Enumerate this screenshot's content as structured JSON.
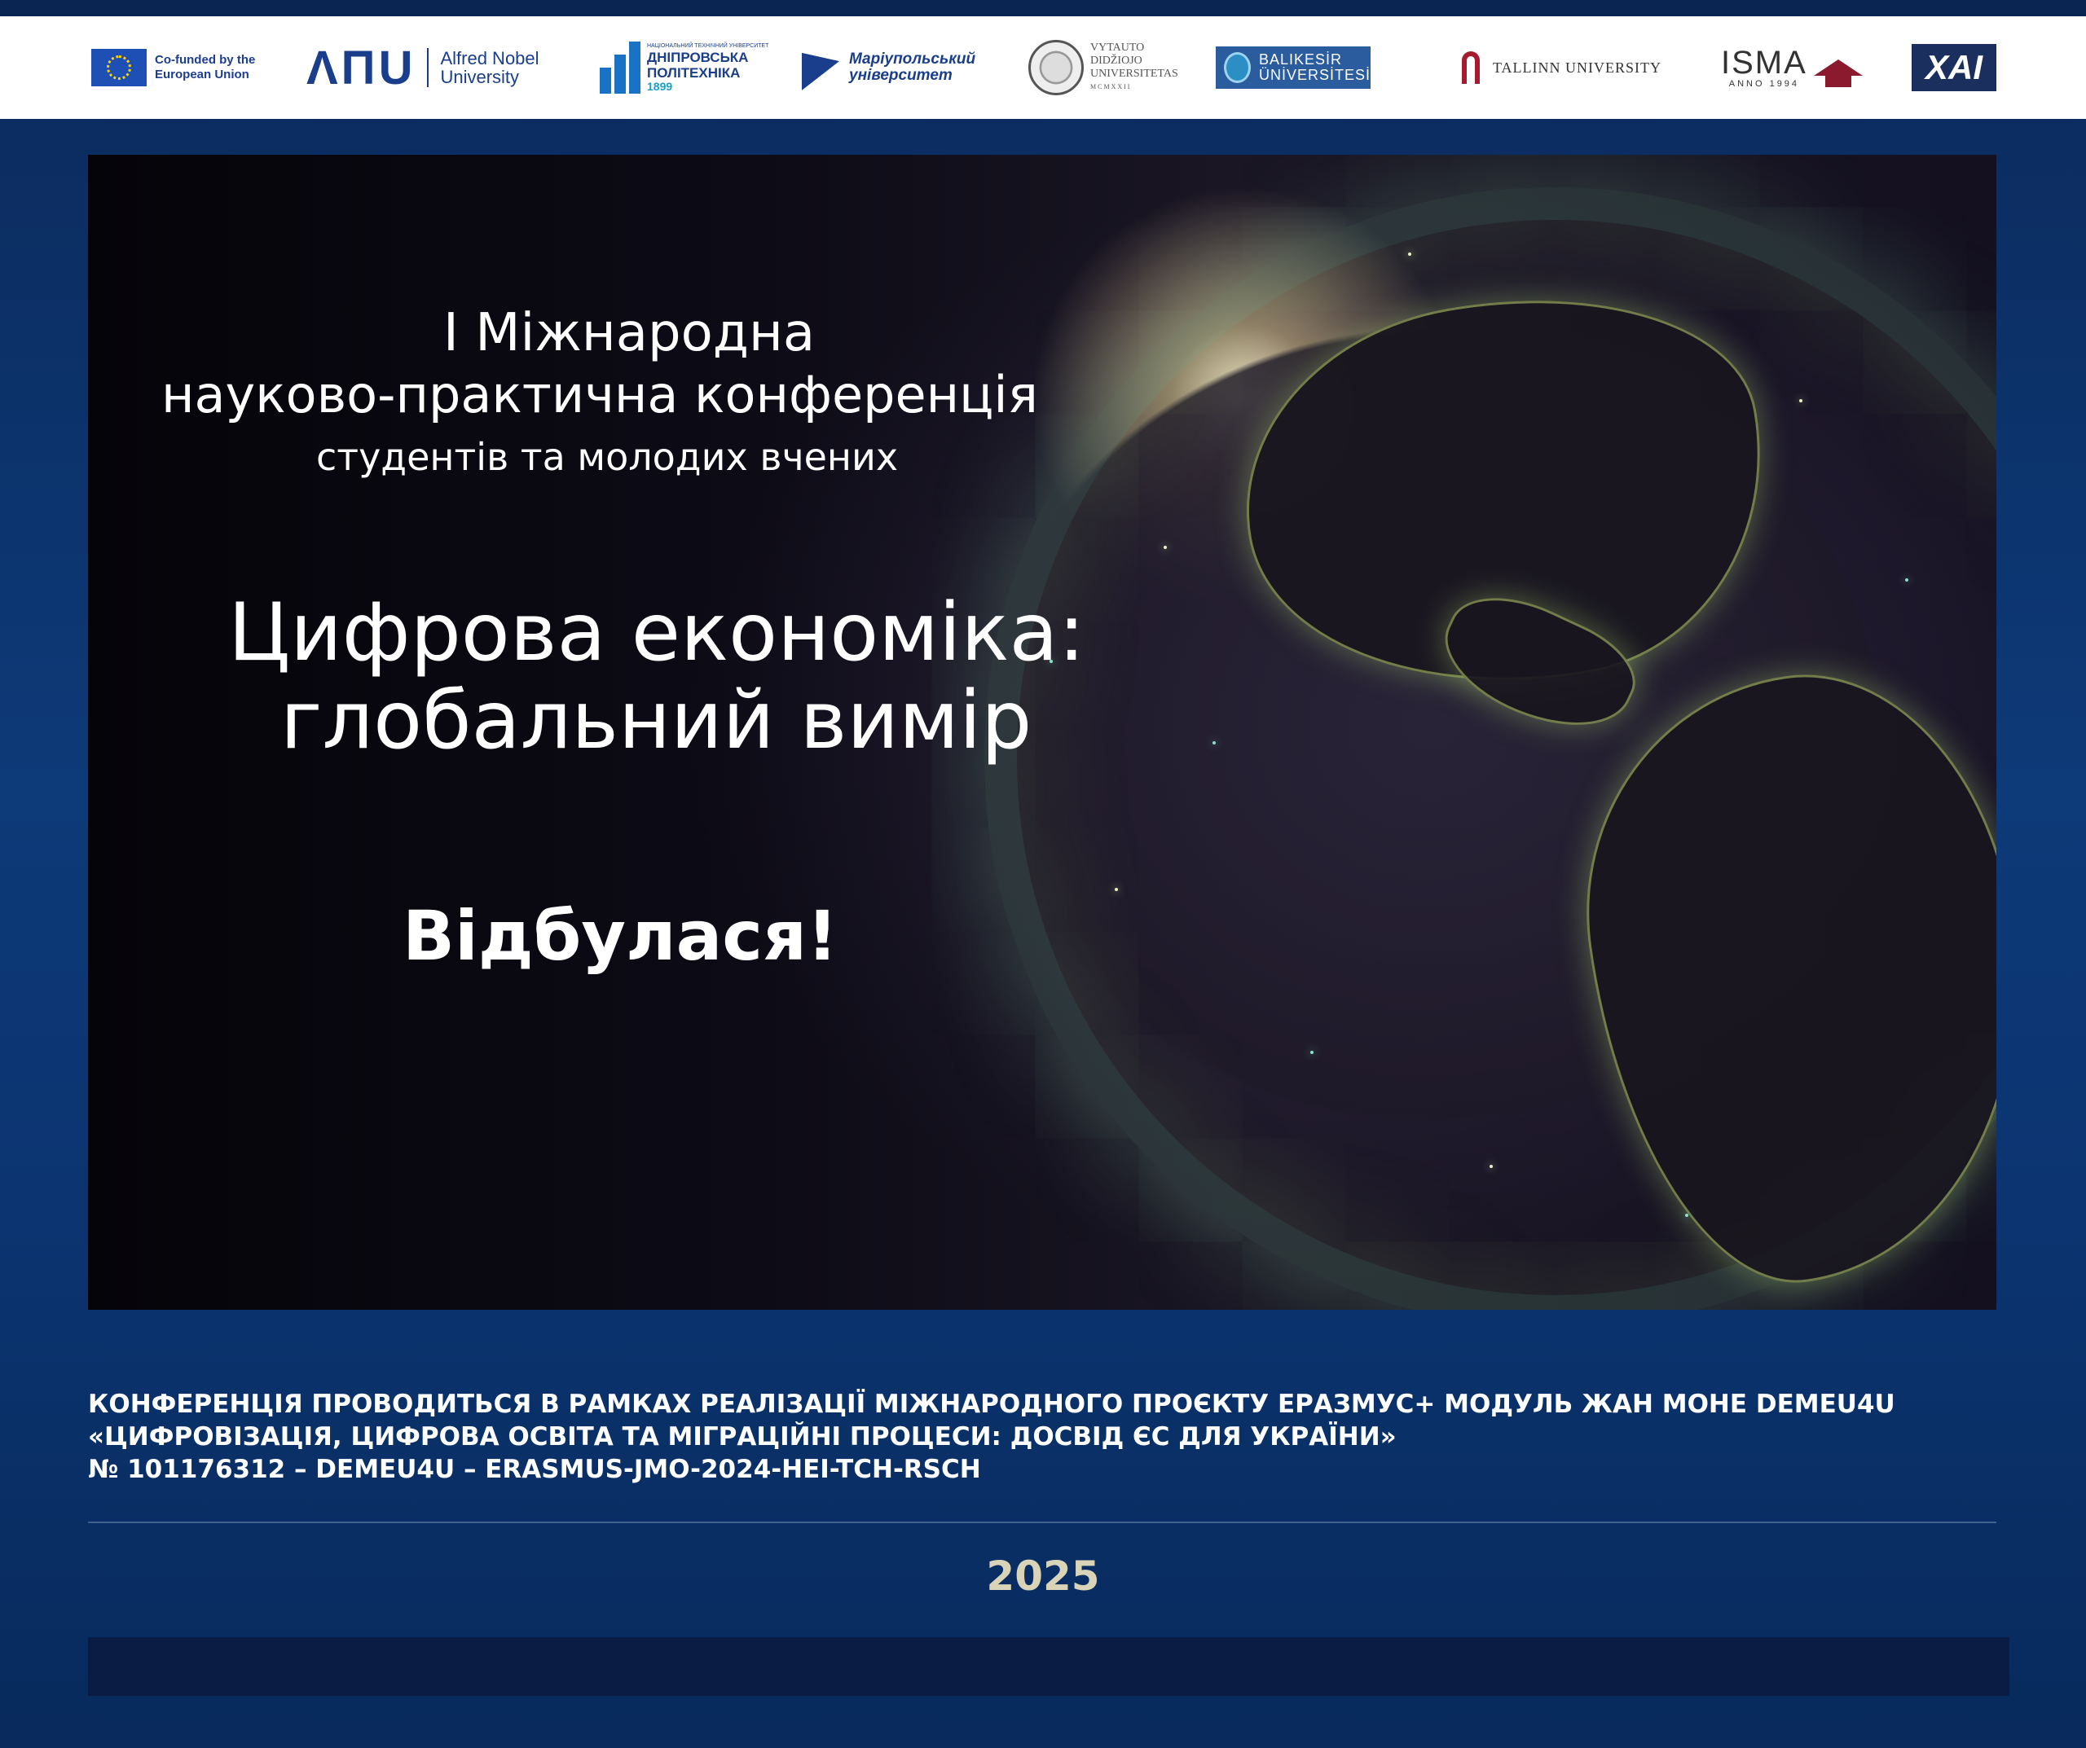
{
  "logos": {
    "eu": {
      "text": "Co-funded by the European Union",
      "flag_color": "#1d4fb5"
    },
    "anu": {
      "mark": "ΛΠU",
      "text": "Alfred Nobel University"
    },
    "dnipro": {
      "small": "НАЦІОНАЛЬНИЙ ТЕХНІЧНИЙ УНІВЕРСИТЕТ",
      "line1": "ДНІПРОВСЬКА",
      "line2": "ПОЛІТЕХНІКА",
      "year": "1899"
    },
    "mariupol": {
      "text": "Маріупольський університет"
    },
    "vytauto": {
      "line1": "VYTAUTO",
      "line2": "DIDŽIOJO",
      "line3": "UNIVERSITETAS",
      "line4": "MCMXXII"
    },
    "balikesir": {
      "line1": "BALIKESİR",
      "line2": "ÜNİVERSİTESİ"
    },
    "tallinn": {
      "text": "TALLINN UNIVERSITY"
    },
    "isma": {
      "name": "ISMA",
      "sub": "ANNO 1994"
    },
    "khai": {
      "text": "ХАІ"
    }
  },
  "hero": {
    "line1": "І Міжнародна",
    "line2": "науково-практична конференція",
    "line3": "студентів та молодих вчених",
    "title_line1": "Цифрова економіка:",
    "title_line2": "глобальний вимір",
    "status": "Відбулася!"
  },
  "note": {
    "line1": "КОНФЕРЕНЦІЯ ПРОВОДИТЬСЯ В РАМКАХ РЕАЛІЗАЦІЇ МІЖНАРОДНОГО ПРОЄКТУ ЕРАЗМУС+ МОДУЛЬ ЖАН МОНЕ DEMEU4U",
    "line2": "«ЦИФРОВІЗАЦІЯ, ЦИФРОВА ОСВІТА ТА МІГРАЦІЙНІ ПРОЦЕСИ: ДОСВІД ЄС ДЛЯ УКРАЇНИ»",
    "line3": "№ 101176312 – DEMEU4U – ERASMUS-JMO-2024-HEI-TCH-RSCH"
  },
  "year": "2025",
  "colors": {
    "background": "#0d3a78",
    "year_text": "#d9d4b8",
    "bottom_bar": "#0a1c44"
  }
}
